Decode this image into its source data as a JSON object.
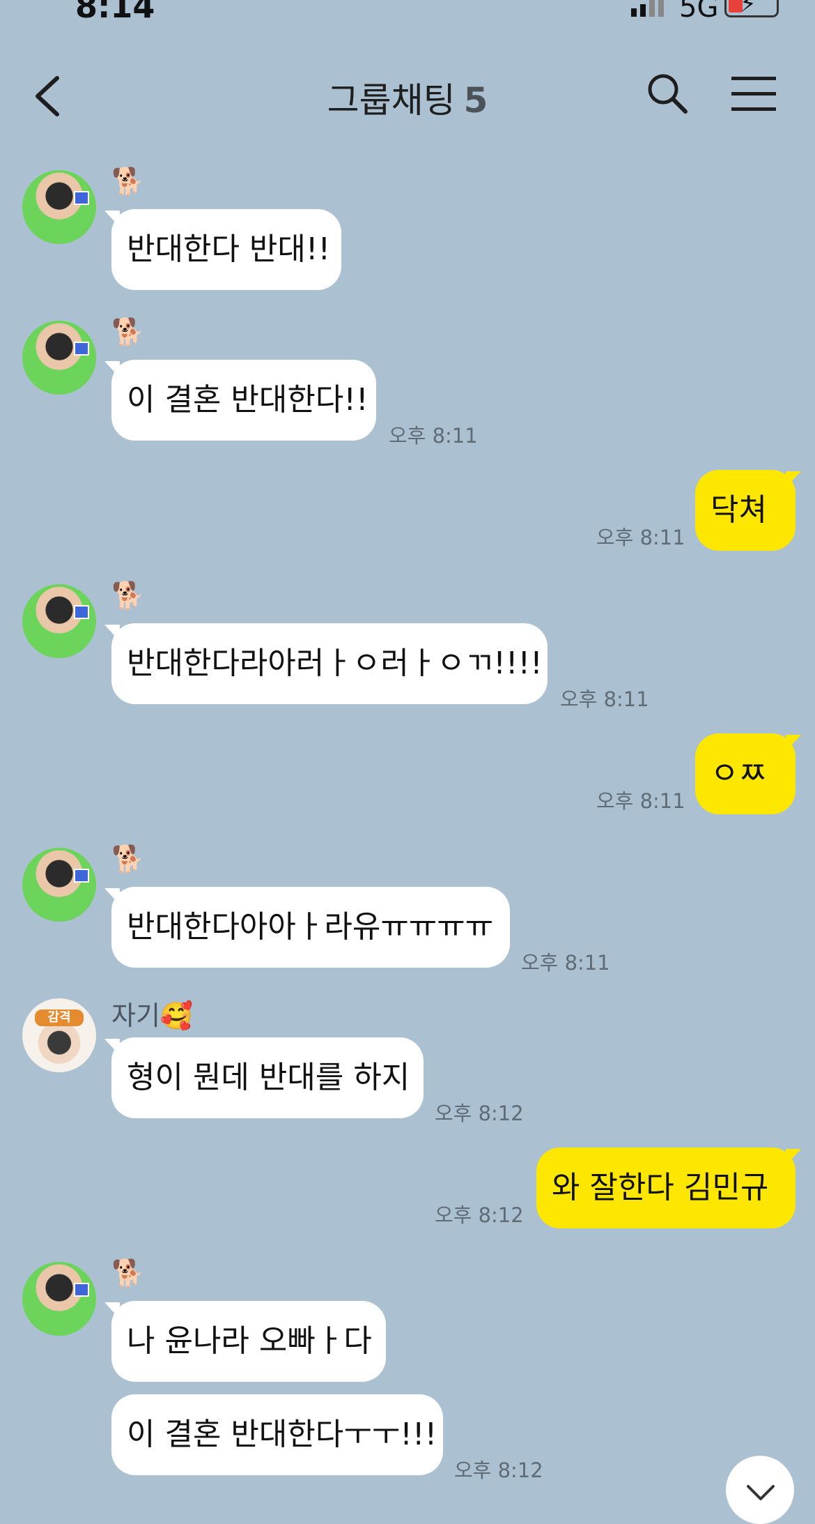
{
  "status_bar": {
    "time": "8:14",
    "network": "5G"
  },
  "header": {
    "title": "그룹채팅",
    "member_count": "5"
  },
  "senders": {
    "dog": "🐕",
    "jagi": "자기🥰"
  },
  "avatar_b_tag": "감격",
  "messages": [
    {
      "side": "in",
      "text": "반대한다 반대!!",
      "time": ""
    },
    {
      "side": "in",
      "text": "이 결혼 반대한다!!",
      "time": "오후 8:11"
    },
    {
      "side": "out",
      "text": "닥쳐",
      "time": "오후 8:11"
    },
    {
      "side": "in",
      "text": "반대한다라아러ㅏㅇ러ㅏㅇㄲ!!!!",
      "time": "오후 8:11"
    },
    {
      "side": "out",
      "text": "ㅇㅉ",
      "time": "오후 8:11"
    },
    {
      "side": "in",
      "text": "반대한다아아ㅏ라유ㅠㅠㅠㅠ",
      "time": "오후 8:11"
    },
    {
      "side": "in",
      "text": "형이 뭔데 반대를 하지",
      "time": "오후 8:12"
    },
    {
      "side": "out",
      "text": "와 잘한다 김민규",
      "time": "오후 8:12"
    },
    {
      "side": "in",
      "text": "나 윤나라 오빠ㅏ다",
      "time": ""
    },
    {
      "side": "in",
      "text": "이 결혼 반대한다ㅜㅜ!!!",
      "time": "오후 8:12"
    }
  ]
}
